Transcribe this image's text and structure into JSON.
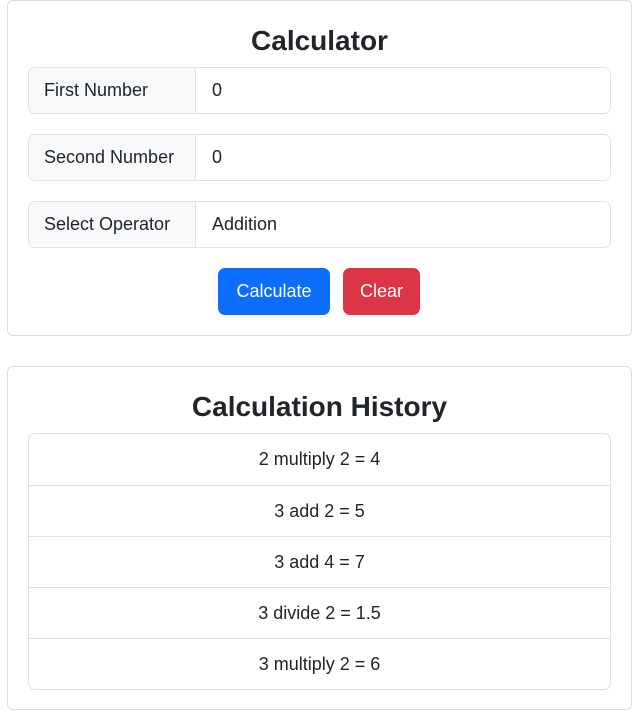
{
  "calculator": {
    "title": "Calculator",
    "first_label": "First Number",
    "first_value": "0",
    "second_label": "Second Number",
    "second_value": "0",
    "operator_label": "Select Operator",
    "operator_value": "Addition",
    "calculate_label": "Calculate",
    "clear_label": "Clear"
  },
  "history": {
    "title": "Calculation History",
    "items": [
      "2 multiply 2 = 4",
      "3 add 2 = 5",
      "3 add 4 = 7",
      "3 divide 2 = 1.5",
      "3 multiply 2 = 6"
    ]
  },
  "colors": {
    "primary": "#0d6efd",
    "danger": "#dc3545"
  }
}
